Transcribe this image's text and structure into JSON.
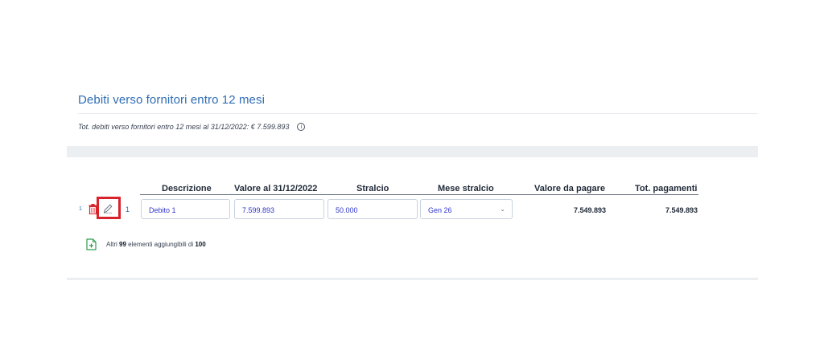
{
  "section": {
    "title": "Debiti verso fornitori entro 12 mesi",
    "summary": "Tot. debiti verso fornitori entro 12 mesi al 31/12/2022: € 7.599.893",
    "info_icon": "info-icon"
  },
  "table": {
    "headers": {
      "descrizione": "Descrizione",
      "valore": "Valore al 31/12/2022",
      "stralcio": "Stralcio",
      "mese_stralcio": "Mese stralcio",
      "valore_da_pagare": "Valore da pagare",
      "tot_pagamenti": "Tot. pagamenti"
    },
    "rows": [
      {
        "index": "1",
        "number": "1",
        "descrizione": "Debito 1",
        "valore": "7.599.893",
        "stralcio": "50.000",
        "mese_stralcio": "Gen 26",
        "valore_da_pagare": "7.549.893",
        "tot_pagamenti": "7.549.893"
      }
    ]
  },
  "add_more": {
    "prefix": "Altri",
    "count": "99",
    "middle": "elementi aggiungibili di",
    "max": "100"
  },
  "icons": {
    "delete": "trash-icon",
    "edit": "pencil-icon",
    "add": "add-document-icon",
    "dropdown": "chevron-down-icon"
  },
  "colors": {
    "title": "#2f6db5",
    "field_text": "#2f35c8",
    "delete_icon": "#d9232a",
    "highlight": "#d9232a",
    "add_icon": "#2e9d4f"
  }
}
